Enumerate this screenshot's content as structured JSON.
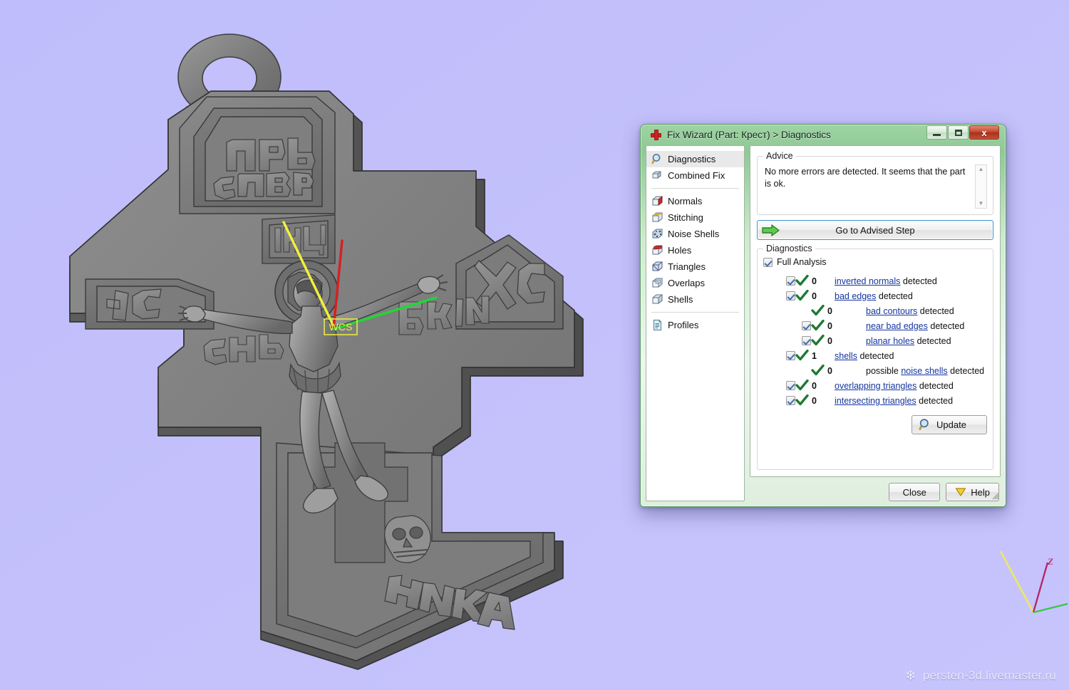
{
  "viewport": {
    "background_color": "#c0bdfa",
    "model_name": "Крест",
    "wcs_label": "WCS",
    "carved_text": {
      "top_plate": [
        "ЦРЬ",
        "СЛВЫ"
      ],
      "titulus": "ІНЦІ",
      "left_arm": "ІС",
      "right_arm": "ХС",
      "under_left_arm": "СНЪ",
      "under_right_arm": "БЖІИ",
      "bottom_plate": "НИКА"
    },
    "axis_triad": {
      "z_label": "Z",
      "x_color": "#35c84a",
      "y_color": "#ecec55",
      "z_color": "#b52a6a"
    },
    "wcs_axis_colors": {
      "yellow": "#f2f23a",
      "red": "#d62020",
      "green": "#1fd832"
    }
  },
  "watermark": {
    "icon": "flower-icon",
    "text": "persten-3d.livemaster.ru"
  },
  "dialog": {
    "title": "Fix Wizard (Part: Крест) > Diagnostics",
    "app_icon": "red-cross-icon",
    "window_buttons": {
      "minimize": "minimize-icon",
      "maximize": "maximize-icon",
      "close": "x"
    },
    "sidebar": {
      "groups": [
        {
          "items": [
            {
              "label": "Diagnostics",
              "icon": "magnifier-icon",
              "selected": true
            },
            {
              "label": "Combined Fix",
              "icon": "stacked-cubes-icon",
              "selected": false
            }
          ]
        },
        {
          "items": [
            {
              "label": "Normals",
              "icon": "cube-red-face-icon",
              "selected": false
            },
            {
              "label": "Stitching",
              "icon": "cube-seam-icon",
              "selected": false
            },
            {
              "label": "Noise Shells",
              "icon": "cube-speckled-icon",
              "selected": false
            },
            {
              "label": "Holes",
              "icon": "cube-hole-icon",
              "selected": false
            },
            {
              "label": "Triangles",
              "icon": "cube-triangles-icon",
              "selected": false
            },
            {
              "label": "Overlaps",
              "icon": "cube-overlap-icon",
              "selected": false
            },
            {
              "label": "Shells",
              "icon": "cube-plain-icon",
              "selected": false
            }
          ]
        },
        {
          "items": [
            {
              "label": "Profiles",
              "icon": "document-icon",
              "selected": false
            }
          ]
        }
      ]
    },
    "advice": {
      "group_title": "Advice",
      "text": "No more errors are detected. It seems that the part is ok.",
      "scroll_up": "▲",
      "scroll_down": "▼"
    },
    "advised_step_button": {
      "label": "Go to Advised Step",
      "icon": "green-arrow-right-icon"
    },
    "diagnostics": {
      "group_title": "Diagnostics",
      "full_analysis": {
        "label": "Full Analysis",
        "checked": true
      },
      "rows": [
        {
          "indent": 0,
          "has_checkbox": true,
          "checked": true,
          "count": "0",
          "link": "inverted normals",
          "suffix": " detected",
          "prefix": ""
        },
        {
          "indent": 0,
          "has_checkbox": true,
          "checked": true,
          "count": "0",
          "link": "bad edges",
          "suffix": " detected",
          "prefix": ""
        },
        {
          "indent": 1,
          "has_checkbox": false,
          "checked": false,
          "count": "0",
          "link": "bad contours",
          "suffix": " detected",
          "prefix": ""
        },
        {
          "indent": 1,
          "has_checkbox": true,
          "checked": true,
          "count": "0",
          "link": "near bad edges",
          "suffix": " detected",
          "prefix": ""
        },
        {
          "indent": 1,
          "has_checkbox": true,
          "checked": true,
          "count": "0",
          "link": "planar holes",
          "suffix": " detected",
          "prefix": ""
        },
        {
          "indent": 0,
          "has_checkbox": true,
          "checked": true,
          "count": "1",
          "link": "shells",
          "suffix": " detected",
          "prefix": ""
        },
        {
          "indent": 1,
          "has_checkbox": false,
          "checked": false,
          "count": "0",
          "link": "noise shells",
          "suffix": " detected",
          "prefix": "possible "
        },
        {
          "indent": 0,
          "has_checkbox": true,
          "checked": true,
          "count": "0",
          "link": "overlapping triangles",
          "suffix": " detected",
          "prefix": ""
        },
        {
          "indent": 0,
          "has_checkbox": true,
          "checked": true,
          "count": "0",
          "link": "intersecting triangles",
          "suffix": " detected",
          "prefix": ""
        }
      ],
      "update_button": {
        "label": "Update",
        "icon": "magnifier-icon"
      }
    },
    "footer": {
      "close_label": "Close",
      "help_label": "Help",
      "help_icon": "yellow-triangle-icon"
    },
    "colors": {
      "frame_green": "#8ec994",
      "link_blue": "#15359e",
      "tick_green": "#1f7a33",
      "accent_blue": "#3c93c6"
    }
  }
}
